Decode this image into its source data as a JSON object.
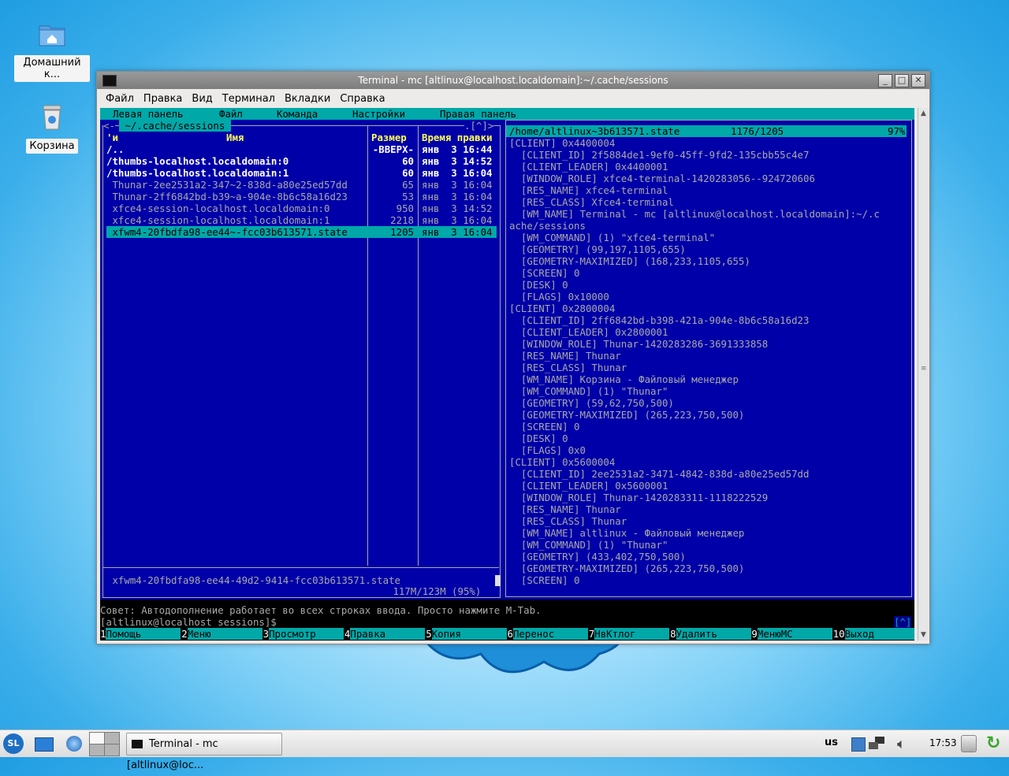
{
  "desktop": {
    "icons": [
      {
        "label": "Домашний к..."
      },
      {
        "label": "Корзина"
      }
    ]
  },
  "window": {
    "title": "Terminal - mc [altlinux@localhost.localdomain]:~/.cache/sessions",
    "menu": [
      "Файл",
      "Правка",
      "Вид",
      "Терминал",
      "Вкладки",
      "Справка"
    ]
  },
  "mc": {
    "topmenu": [
      "Левая панель",
      "Файл",
      "Команда",
      "Настройки",
      "Правая панель"
    ],
    "left": {
      "path": " ~/.cache/sessions ",
      "corner": ".[^]>",
      "headers": {
        "sort": "'и",
        "name": "Имя",
        "size": "Размер",
        "mtime": "Время правки"
      },
      "files": [
        {
          "name": "/..",
          "size": "-ВВЕРХ-",
          "date": "янв  3 16:44",
          "kind": "dir"
        },
        {
          "name": "/thumbs-localhost.localdomain:0",
          "size": "60",
          "date": "янв  3 14:52",
          "kind": "dir"
        },
        {
          "name": "/thumbs-localhost.localdomain:1",
          "size": "60",
          "date": "янв  3 16:04",
          "kind": "dir"
        },
        {
          "name": " Thunar-2ee2531a2-347~2-838d-a80e25ed57dd",
          "size": "65",
          "date": "янв  3 16:04",
          "kind": "file"
        },
        {
          "name": " Thunar-2ff6842bd-b39~a-904e-8b6c58a16d23",
          "size": "53",
          "date": "янв  3 16:04",
          "kind": "file"
        },
        {
          "name": " xfce4-session-localhost.localdomain:0",
          "size": "950",
          "date": "янв  3 14:52",
          "kind": "file"
        },
        {
          "name": " xfce4-session-localhost.localdomain:1",
          "size": "2218",
          "date": "янв  3 16:04",
          "kind": "file"
        },
        {
          "name": " xfwm4-20fbdfa98-ee44~-fcc03b613571.state",
          "size": "1205",
          "date": "янв  3 16:04",
          "kind": "selected"
        }
      ],
      "status": " xfwm4-20fbdfa98-ee44-49d2-9414-fcc03b613571.state",
      "disk": " 117M/123M (95%) "
    },
    "right": {
      "header_path": "/home/altlinux~3b613571.state",
      "header_pos": "1176/1205",
      "header_pct": "97%",
      "lines": [
        "[CLIENT] 0x4400004",
        "  [CLIENT_ID] 2f5884de1-9ef0-45ff-9fd2-135cbb55c4e7",
        "  [CLIENT_LEADER] 0x4400001",
        "  [WINDOW_ROLE] xfce4-terminal-1420283056--924720606",
        "  [RES_NAME] xfce4-terminal",
        "  [RES_CLASS] Xfce4-terminal",
        "  [WM_NAME] Terminal - mc [altlinux@localhost.localdomain]:~/.c",
        "ache/sessions",
        "  [WM_COMMAND] (1) \"xfce4-terminal\"",
        "  [GEOMETRY] (99,197,1105,655)",
        "  [GEOMETRY-MAXIMIZED] (168,233,1105,655)",
        "  [SCREEN] 0",
        "  [DESK] 0",
        "  [FLAGS] 0x10000",
        "[CLIENT] 0x2800004",
        "  [CLIENT_ID] 2ff6842bd-b398-421a-904e-8b6c58a16d23",
        "  [CLIENT_LEADER] 0x2800001",
        "  [WINDOW_ROLE] Thunar-1420283286-3691333858",
        "  [RES_NAME] Thunar",
        "  [RES_CLASS] Thunar",
        "  [WM_NAME] Корзина - Файловый менеджер",
        "  [WM_COMMAND] (1) \"Thunar\"",
        "  [GEOMETRY] (59,62,750,500)",
        "  [GEOMETRY-MAXIMIZED] (265,223,750,500)",
        "  [SCREEN] 0",
        "  [DESK] 0",
        "  [FLAGS] 0x0",
        "[CLIENT] 0x5600004",
        "  [CLIENT_ID] 2ee2531a2-3471-4842-838d-a80e25ed57dd",
        "  [CLIENT_LEADER] 0x5600001",
        "  [WINDOW_ROLE] Thunar-1420283311-1118222529",
        "  [RES_NAME] Thunar",
        "  [RES_CLASS] Thunar",
        "  [WM_NAME] altlinux - Файловый менеджер",
        "  [WM_COMMAND] (1) \"Thunar\"",
        "  [GEOMETRY] (433,402,750,500)",
        "  [GEOMETRY-MAXIMIZED] (265,223,750,500)",
        "  [SCREEN] 0"
      ]
    },
    "hint": "Совет: Автодополнение работает во всех строках ввода. Просто нажмите M-Tab.",
    "prompt": "[altlinux@localhost sessions]$",
    "prompt_corner": "[^]",
    "fkeys": [
      {
        "n": "1",
        "label": "Помощь"
      },
      {
        "n": "2",
        "label": "Меню"
      },
      {
        "n": "3",
        "label": "Просмотр"
      },
      {
        "n": "4",
        "label": "Правка"
      },
      {
        "n": "5",
        "label": "Копия"
      },
      {
        "n": "6",
        "label": "Перенос"
      },
      {
        "n": "7",
        "label": "НвКтлог"
      },
      {
        "n": "8",
        "label": "Удалить"
      },
      {
        "n": "9",
        "label": "МенюMC"
      },
      {
        "n": "10",
        "label": "Выход"
      }
    ]
  },
  "taskbar": {
    "start_label": "SL",
    "task_title": "Terminal - mc [altlinux@loc...",
    "keyboard_layout": "us",
    "clock": "17:53"
  }
}
